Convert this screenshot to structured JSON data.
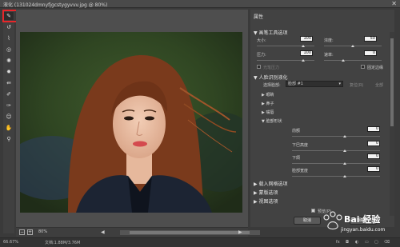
{
  "window": {
    "title": "液化 (131024dmnyfjgcstygyvvv.jpg @ 80%)",
    "close": "✕"
  },
  "tools": [
    {
      "name": "forward-warp-tool",
      "glyph": "✎"
    },
    {
      "name": "reconstruct-tool",
      "glyph": "↺"
    },
    {
      "name": "smooth-tool",
      "glyph": "⌇"
    },
    {
      "name": "twirl-tool",
      "glyph": "◎"
    },
    {
      "name": "pucker-tool",
      "glyph": "✺"
    },
    {
      "name": "bloat-tool",
      "glyph": "✹"
    },
    {
      "name": "push-left-tool",
      "glyph": "⇚"
    },
    {
      "name": "freeze-mask-tool",
      "glyph": "✐"
    },
    {
      "name": "thaw-mask-tool",
      "glyph": "✑"
    },
    {
      "name": "face-tool",
      "glyph": "☺"
    },
    {
      "name": "hand-tool",
      "glyph": "✋"
    },
    {
      "name": "zoom-tool",
      "glyph": "⚲"
    }
  ],
  "canvas": {
    "zoom": "80%"
  },
  "properties": {
    "title": "属性",
    "brush_tools_head": "画笔工具选项",
    "size_label": "大小:",
    "size_value": "100",
    "density_label": "浓度:",
    "density_value": "50",
    "pressure_label": "压力:",
    "pressure_value": "100",
    "rate_label": "速率:",
    "rate_value": "0",
    "stylus_label": "光笔压力",
    "pin_edges_label": "固定边缘",
    "face_aware_head": "人脸识别液化",
    "select_face_label": "选择脸部:",
    "select_face_value": "脸部 #1",
    "reset_label": "复位(R)",
    "all_label": "全部",
    "eyes_label": "眼睛",
    "nose_label": "鼻子",
    "mouth_label": "嘴唇",
    "face_shape_head": "脸部形状",
    "forehead_label": "前额",
    "forehead_value": "0",
    "chin_height_label": "下巴高度",
    "chin_height_value": "0",
    "jawline_label": "下颌",
    "jawline_value": "0",
    "face_width_label": "脸部宽度",
    "face_width_value": "0",
    "load_mesh_head": "载入网格选项",
    "mask_options_head": "蒙版选项",
    "view_options_head": "视图选项",
    "preview_label": "预览(P)",
    "cancel_label": "取消",
    "ok_label": "确定"
  },
  "status": {
    "zoom": "66.67%",
    "doc": "文档:1.88M/3.76M"
  },
  "watermark": {
    "line1": "Bai 经验",
    "line2": "jingyan.baidu.com"
  }
}
